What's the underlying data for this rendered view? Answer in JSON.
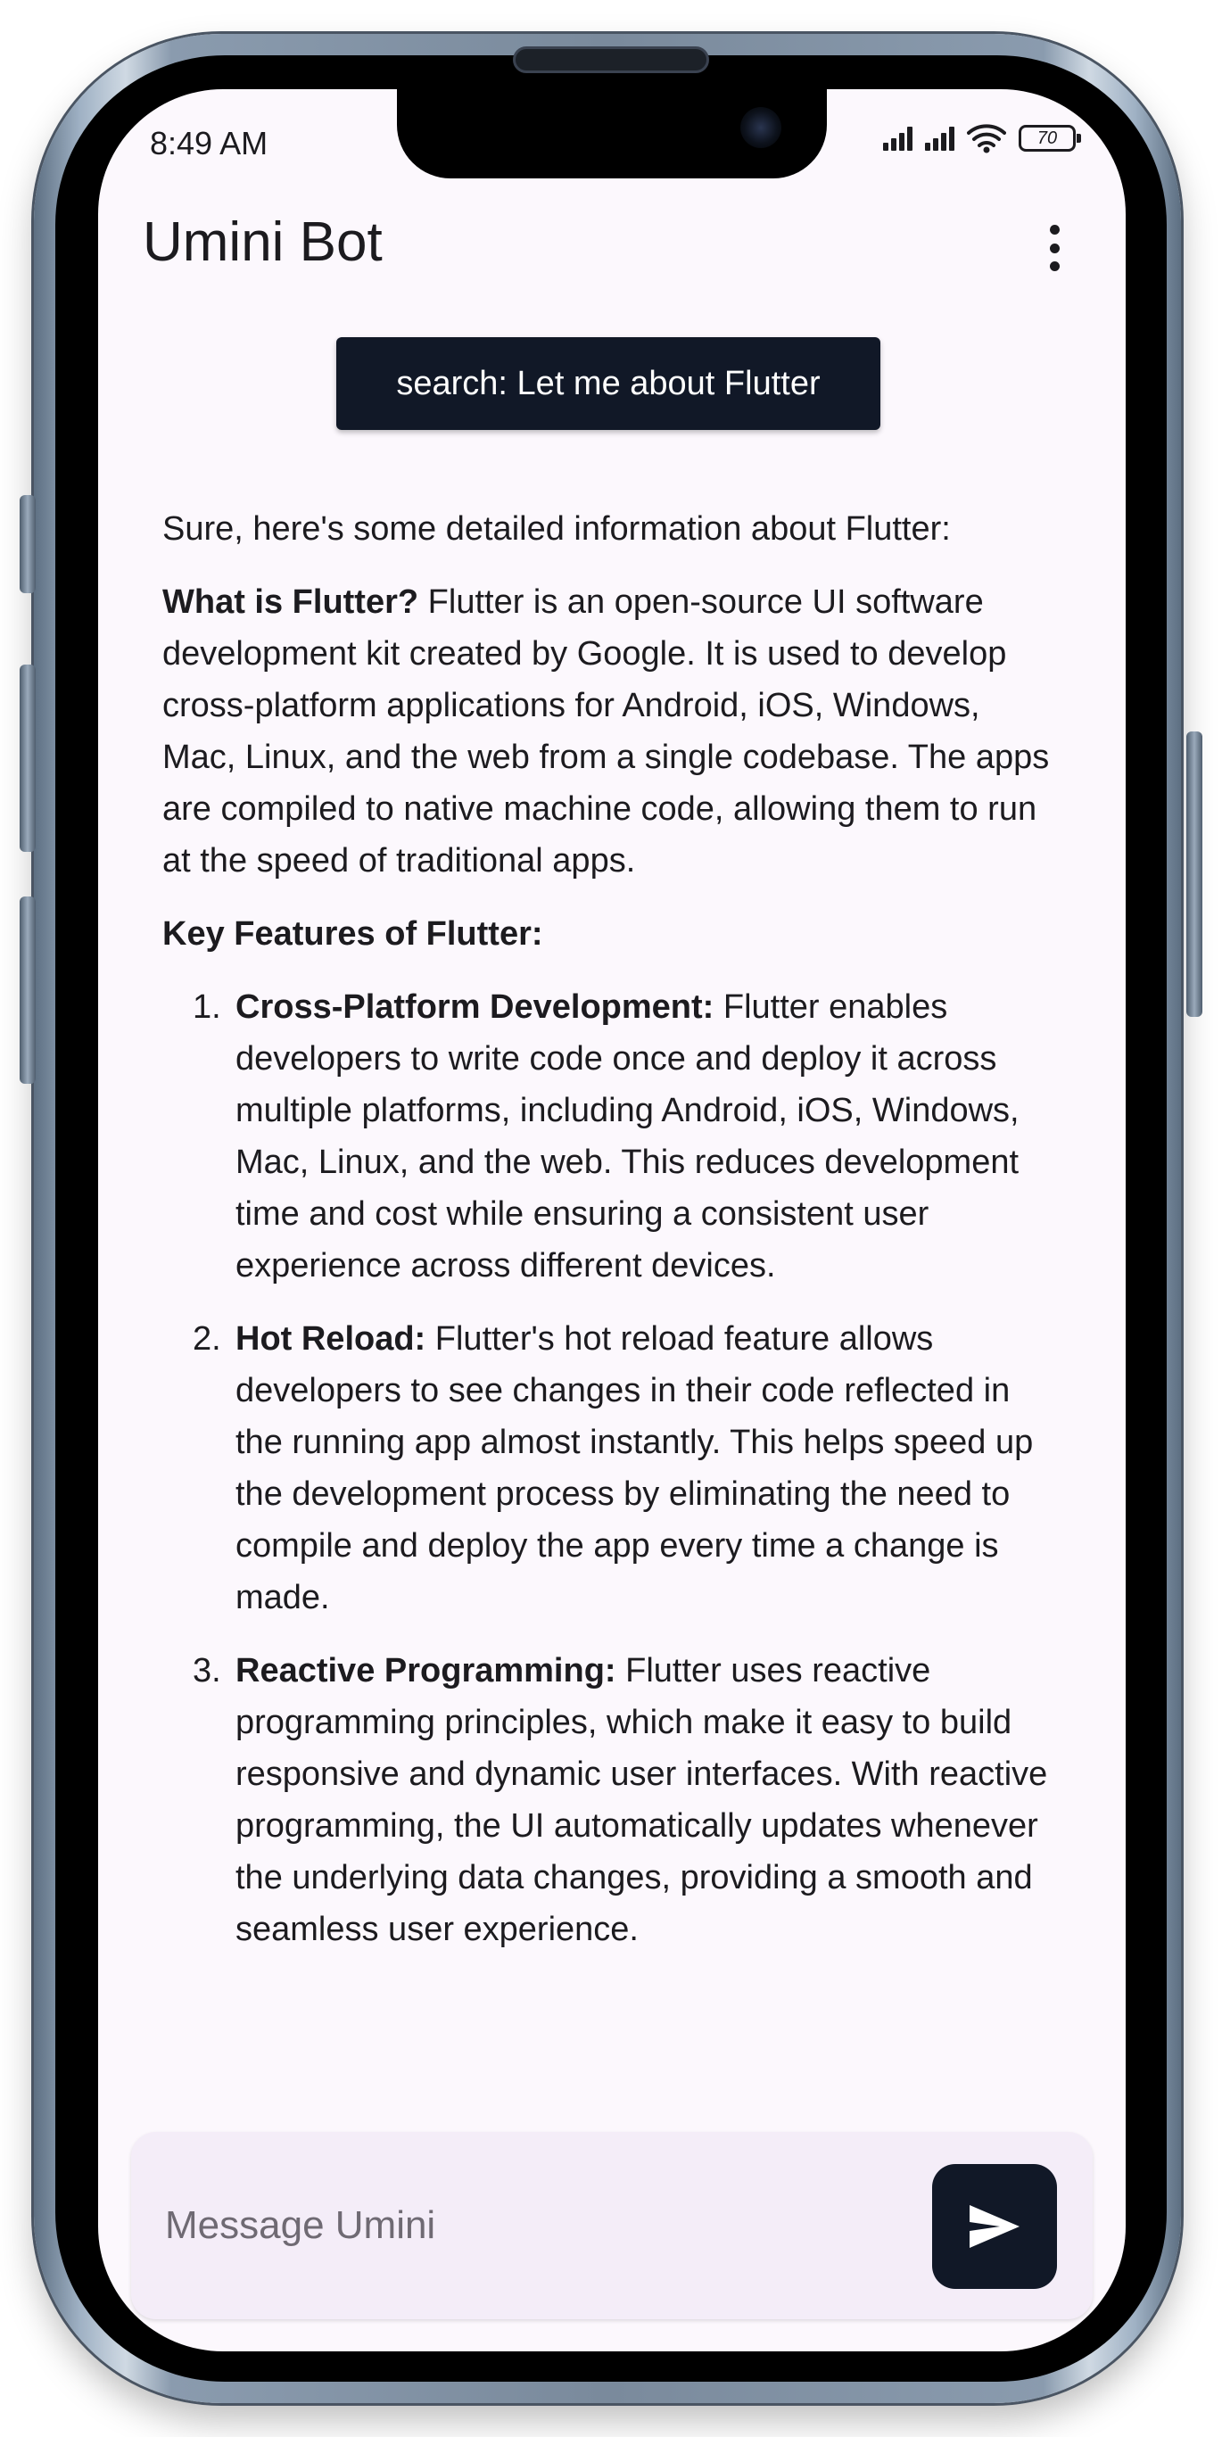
{
  "status_bar": {
    "time": "8:49 AM",
    "battery": "70"
  },
  "app_bar": {
    "title": "Umini Bot",
    "menu_icon": "more-vert-icon"
  },
  "query_chip": {
    "label": "search: Let me about Flutter"
  },
  "response": {
    "intro": "Sure, here's some detailed information about Flutter:",
    "what_is_heading": "What is Flutter?",
    "what_is_text": " Flutter is an open-source UI software development kit created by Google. It is used to develop cross-platform applications for Android, iOS, Windows, Mac, Linux, and the web from a single codebase. The apps are compiled to native machine code, allowing them to run at the speed of traditional apps.",
    "features_heading": "Key Features of Flutter:",
    "features": [
      {
        "number": "1.",
        "title": "Cross-Platform Development:",
        "text": " Flutter enables developers to write code once and deploy it across multiple platforms, including Android, iOS, Windows, Mac, Linux, and the web. This reduces development time and cost while ensuring a consistent user experience across different devices."
      },
      {
        "number": "2.",
        "title": "Hot Reload:",
        "text": " Flutter's hot reload feature allows developers to see changes in their code reflected in the running app almost instantly. This helps speed up the development process by eliminating the need to compile and deploy the app every time a change is made."
      },
      {
        "number": "3.",
        "title": "Reactive Programming:",
        "text": " Flutter uses reactive programming principles, which make it easy to build responsive and dynamic user interfaces. With reactive programming, the UI automatically updates whenever the underlying data changes, providing a smooth and seamless user experience."
      }
    ]
  },
  "input": {
    "placeholder": "Message Umini",
    "value": "",
    "send_icon": "send-icon"
  },
  "colors": {
    "screen_background": "#fcf8fd",
    "accent_dark": "#111827",
    "input_background": "#f4edf8",
    "text": "#1c1b1f"
  }
}
